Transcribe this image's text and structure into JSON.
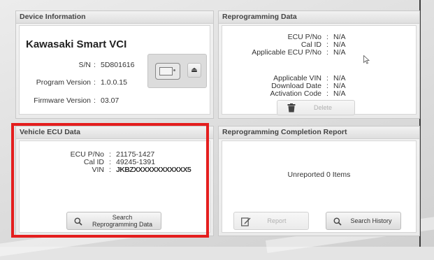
{
  "device_info": {
    "title": "Device Information",
    "brand": "Kawasaki Smart VCI",
    "sn_label": "S/N",
    "sn_value": "5D801616",
    "program_label": "Program Version",
    "program_value": "1.0.0.15",
    "firmware_label": "Firmware Version",
    "firmware_value": "03.07"
  },
  "reprogramming_data": {
    "title": "Reprogramming Data",
    "ecu_pno_label": "ECU P/No",
    "ecu_pno_value": "N/A",
    "cal_id_label": "Cal ID",
    "cal_id_value": "N/A",
    "applicable_ecu_label": "Applicable ECU P/No",
    "applicable_ecu_value": "N/A",
    "applicable_vin_label": "Applicable VIN",
    "applicable_vin_value": "N/A",
    "download_date_label": "Download Date",
    "download_date_value": "N/A",
    "activation_code_label": "Activation Code",
    "activation_code_value": "N/A",
    "delete_label": "Delete"
  },
  "vehicle_ecu": {
    "title": "Vehicle ECU Data",
    "ecu_pno_label": "ECU P/No",
    "ecu_pno_value": "21175-1427",
    "cal_id_label": "Cal ID",
    "cal_id_value": "49245-1391",
    "vin_label": "VIN",
    "vin_value": "JKBZXXXXXXXXXXXX5",
    "search_label": "Search Reprogramming Data"
  },
  "completion_report": {
    "title": "Reprogramming Completion Report",
    "status": "Unreported 0 Items",
    "report_label": "Report",
    "history_label": "Search History"
  },
  "colors": {
    "highlight": "#e41e1e"
  }
}
